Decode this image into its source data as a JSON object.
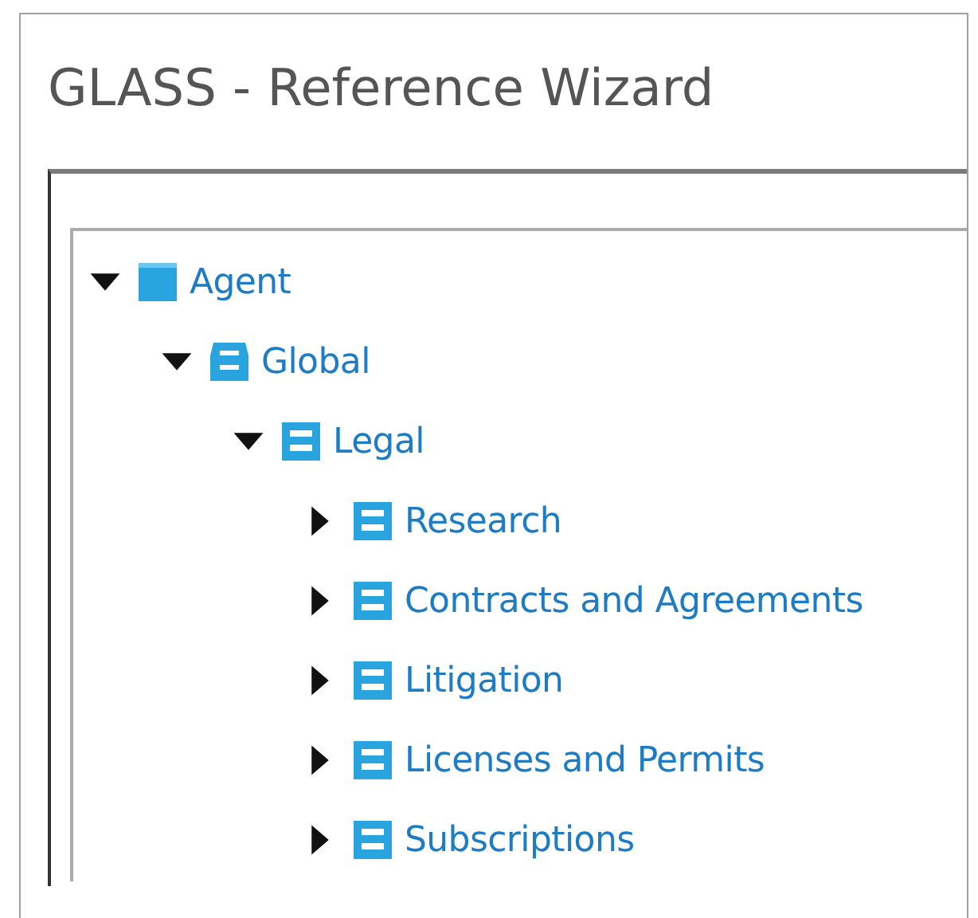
{
  "window": {
    "title": "GLASS - Reference Wizard"
  },
  "tree": [
    {
      "label": "Agent",
      "kind": "solid",
      "expanded": true,
      "children": [
        {
          "label": "Global",
          "kind": "box",
          "expanded": true,
          "children": [
            {
              "label": "Legal",
              "kind": "drawer",
              "expanded": true,
              "children": [
                {
                  "label": "Research",
                  "kind": "drawer",
                  "expanded": false
                },
                {
                  "label": "Contracts and Agreements",
                  "kind": "drawer",
                  "expanded": false
                },
                {
                  "label": "Litigation",
                  "kind": "drawer",
                  "expanded": false
                },
                {
                  "label": "Licenses and Permits",
                  "kind": "drawer",
                  "expanded": false
                },
                {
                  "label": "Subscriptions",
                  "kind": "drawer",
                  "expanded": false
                }
              ]
            }
          ]
        }
      ]
    }
  ]
}
